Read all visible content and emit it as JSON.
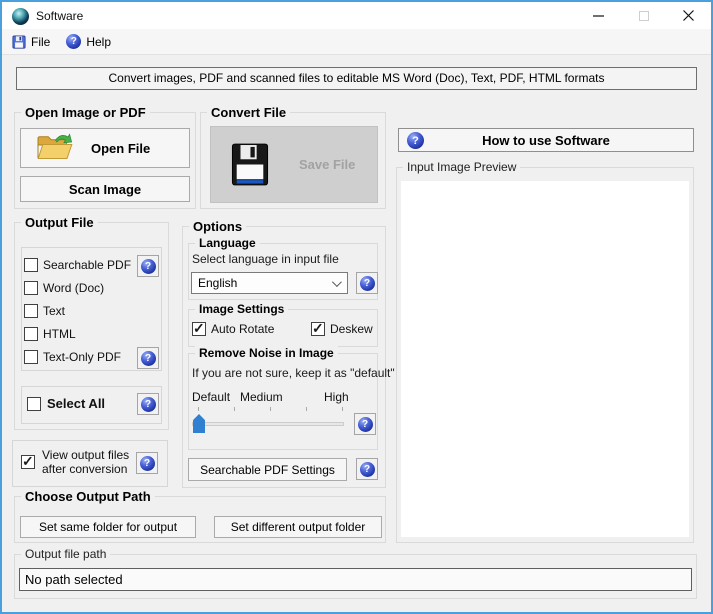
{
  "window": {
    "title": "Software"
  },
  "menubar": {
    "file": "File",
    "help": "Help"
  },
  "banner": {
    "label": "Convert images, PDF and scanned files to editable MS Word (Doc), Text, PDF, HTML formats"
  },
  "open_group": {
    "title": "Open Image or PDF",
    "open_file": "Open File",
    "scan_image": "Scan Image"
  },
  "convert_group": {
    "title": "Convert File",
    "save_file": "Save File",
    "save_enabled": false
  },
  "help_panel": {
    "how_to_use": "How to use Software",
    "preview_title": "Input Image Preview"
  },
  "output_file": {
    "title": "Output File",
    "formats": [
      {
        "label": "Searchable PDF",
        "checked": false,
        "has_help": true
      },
      {
        "label": "Word (Doc)",
        "checked": false,
        "has_help": false
      },
      {
        "label": "Text",
        "checked": false,
        "has_help": false
      },
      {
        "label": "HTML",
        "checked": false,
        "has_help": false
      },
      {
        "label": "Text-Only PDF",
        "checked": false,
        "has_help": true
      }
    ],
    "select_all": {
      "label": "Select All",
      "checked": false
    }
  },
  "options": {
    "title": "Options",
    "language": {
      "title": "Language",
      "hint": "Select language in input file",
      "selected": "English"
    },
    "image_settings": {
      "title": "Image Settings",
      "auto_rotate": {
        "label": "Auto Rotate",
        "checked": true
      },
      "deskew": {
        "label": "Deskew",
        "checked": true
      }
    },
    "remove_noise": {
      "title": "Remove Noise in Image",
      "hint": "If you are not sure, keep it as \"default\"",
      "levels": [
        "Default",
        "Medium",
        "High"
      ],
      "value": "Default"
    },
    "searchable_pdf_settings": "Searchable PDF Settings"
  },
  "view_output": {
    "line1": "View output files",
    "line2": "after conversion",
    "checked": true
  },
  "output_path_group": {
    "title": "Choose Output Path",
    "same_folder": "Set same folder for output",
    "different_folder": "Set different output folder"
  },
  "output_path_field": {
    "title": "Output file path",
    "value": "No path selected"
  },
  "colors": {
    "window_border": "#4aa0dc",
    "help_icon_blue": "#1b2f9c",
    "slider_thumb": "#2f80d0",
    "folder_yellow": "#f3d06a",
    "arrow_green": "#47b04b"
  }
}
